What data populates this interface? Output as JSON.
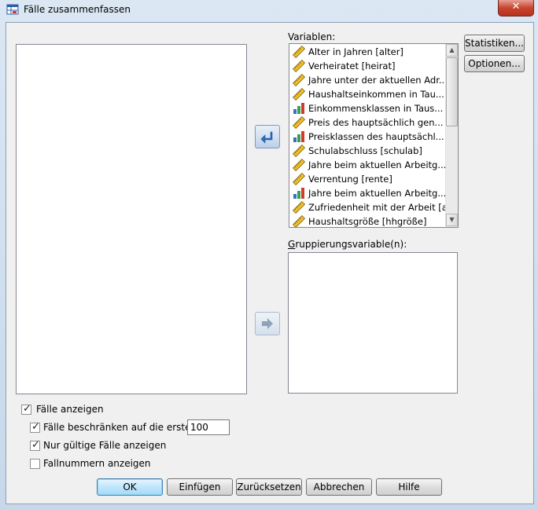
{
  "window": {
    "title": "Fälle zusammenfassen",
    "close_label": "✕"
  },
  "labels": {
    "variables": "Variablen:",
    "grouping": "Gruppierungsvariable(n):"
  },
  "variables": [
    {
      "label": "Alter in Jahren [alter]",
      "type": "scale"
    },
    {
      "label": "Verheiratet [heirat]",
      "type": "scale"
    },
    {
      "label": "Jahre unter der aktuellen Adr...",
      "type": "scale"
    },
    {
      "label": "Haushaltseinkommen in Tau...",
      "type": "scale"
    },
    {
      "label": "Einkommensklassen in Taus...",
      "type": "ordinal"
    },
    {
      "label": "Preis des hauptsächlich gen...",
      "type": "scale"
    },
    {
      "label": "Preisklassen des hauptsächl...",
      "type": "ordinal"
    },
    {
      "label": "Schulabschluss [schulab]",
      "type": "scale"
    },
    {
      "label": "Jahre beim aktuellen Arbeitg...",
      "type": "scale"
    },
    {
      "label": "Verrentung [rente]",
      "type": "scale"
    },
    {
      "label": "Jahre beim aktuellen Arbeitg...",
      "type": "ordinal"
    },
    {
      "label": "Zufriedenheit mit der Arbeit [a...",
      "type": "scale"
    },
    {
      "label": "Haushaltsgröße [hhgröße]",
      "type": "scale"
    }
  ],
  "side_buttons": {
    "statistics": "Statistiken...",
    "options": "Optionen..."
  },
  "checkboxes": {
    "show_cases": {
      "label": "Fälle anzeigen",
      "checked": true
    },
    "limit_cases": {
      "label": "Fälle beschränken auf die ersten",
      "checked": true,
      "value": "100"
    },
    "valid_only": {
      "label": "Nur gültige Fälle anzeigen",
      "checked": true
    },
    "case_numbers": {
      "label": "Fallnummern anzeigen",
      "checked": false
    }
  },
  "buttons": {
    "ok": "OK",
    "paste": "Einfügen",
    "reset": "Zurücksetzen",
    "cancel": "Abbrechen",
    "help": "Hilfe"
  },
  "icons": {
    "scale": "ruler-icon",
    "ordinal": "bar-chart-icon",
    "move_left": "arrow-left-icon",
    "move_right": "arrow-right-icon"
  }
}
